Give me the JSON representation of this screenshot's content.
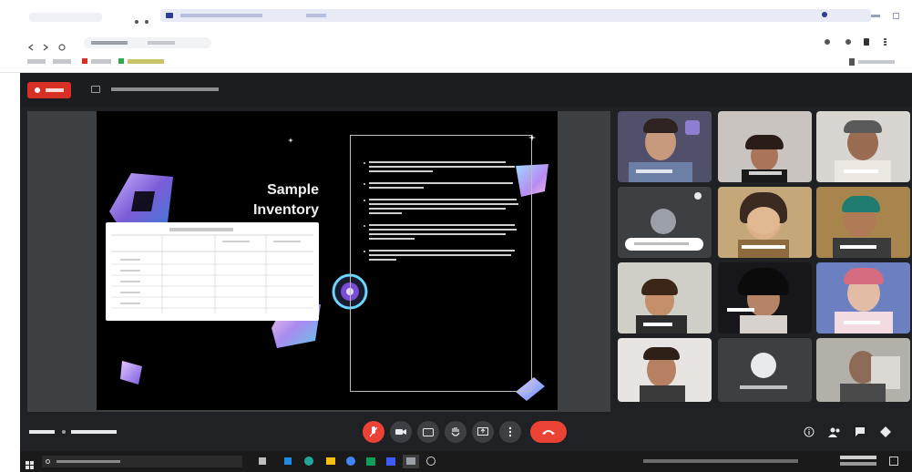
{
  "slide": {
    "title_line1": "Sample",
    "title_line2": "Inventory"
  },
  "colors": {
    "meet_bg": "#202124",
    "stage_bg": "#3c4043",
    "end_call": "#ea4335",
    "accent_purple": "#a78bfa"
  },
  "icons": {
    "mic": "microphone-icon",
    "cam": "camera-icon",
    "cc": "captions-icon",
    "hand": "raise-hand-icon",
    "present": "present-icon",
    "more": "more-icon",
    "end": "end-call-icon",
    "info": "info-icon",
    "people": "people-icon",
    "chat": "chat-icon",
    "activities": "activities-icon"
  }
}
